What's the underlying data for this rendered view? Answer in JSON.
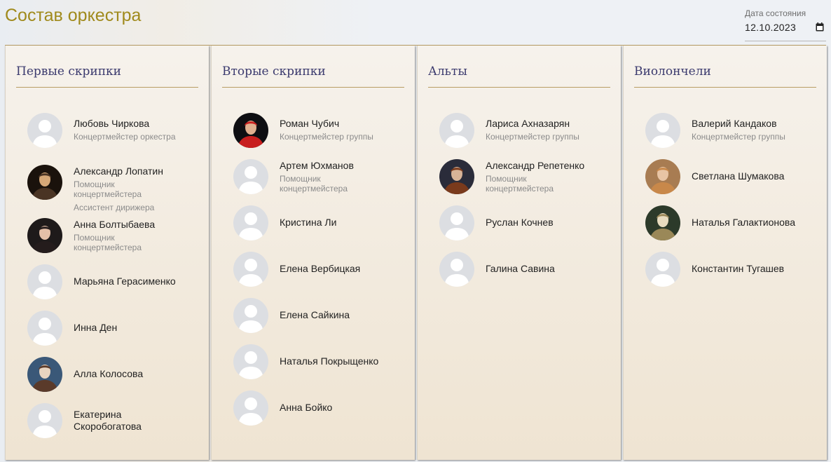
{
  "page": {
    "title": "Состав оркестра"
  },
  "date": {
    "label": "Дата состояния",
    "value": "12.10.2023",
    "icon": "calendar-icon"
  },
  "sections": [
    {
      "title": "Первые скрипки",
      "members": [
        {
          "name": "Любовь Чиркова",
          "roles": [
            "Концертмейстер оркестра"
          ],
          "photo": "placeholder"
        },
        {
          "name": "Александр Лопатин",
          "roles": [
            "Помощник концертмейстера",
            "Ассистент дирижера"
          ],
          "photo": "photo"
        },
        {
          "name": "Анна Болтыбаева",
          "roles": [
            "Помощник концертмейстера"
          ],
          "photo": "photo"
        },
        {
          "name": "Марьяна Герасименко",
          "roles": [],
          "photo": "placeholder"
        },
        {
          "name": "Инна Ден",
          "roles": [],
          "photo": "placeholder"
        },
        {
          "name": "Алла Колосова",
          "roles": [],
          "photo": "photo"
        },
        {
          "name": "Екатерина Скоробогатова",
          "roles": [],
          "photo": "placeholder"
        }
      ]
    },
    {
      "title": "Вторые скрипки",
      "members": [
        {
          "name": "Роман Чубич",
          "roles": [
            "Концертмейстер группы"
          ],
          "photo": "photo"
        },
        {
          "name": "Артем Юхманов",
          "roles": [
            "Помощник концертмейстера"
          ],
          "photo": "placeholder"
        },
        {
          "name": "Кристина Ли",
          "roles": [],
          "photo": "placeholder"
        },
        {
          "name": "Елена Вербицкая",
          "roles": [],
          "photo": "placeholder"
        },
        {
          "name": "Елена Сайкина",
          "roles": [],
          "photo": "placeholder"
        },
        {
          "name": "Наталья Покрыщенко",
          "roles": [],
          "photo": "placeholder"
        },
        {
          "name": "Анна Бойко",
          "roles": [],
          "photo": "placeholder"
        }
      ]
    },
    {
      "title": "Альты",
      "members": [
        {
          "name": "Лариса Ахназарян",
          "roles": [
            "Концертмейстер группы"
          ],
          "photo": "placeholder"
        },
        {
          "name": "Александр Репетенко",
          "roles": [
            "Помощник концертмейстера"
          ],
          "photo": "photo"
        },
        {
          "name": "Руслан Кочнев",
          "roles": [],
          "photo": "placeholder"
        },
        {
          "name": "Галина Савина",
          "roles": [],
          "photo": "placeholder"
        }
      ]
    },
    {
      "title": "Виолончели",
      "members": [
        {
          "name": "Валерий Кандаков",
          "roles": [
            "Концертмейстер группы"
          ],
          "photo": "placeholder"
        },
        {
          "name": "Светлана Шумакова",
          "roles": [],
          "photo": "photo"
        },
        {
          "name": "Наталья Галактионова",
          "roles": [],
          "photo": "photo"
        },
        {
          "name": "Константин Тугашев",
          "roles": [],
          "photo": "placeholder"
        }
      ]
    }
  ]
}
